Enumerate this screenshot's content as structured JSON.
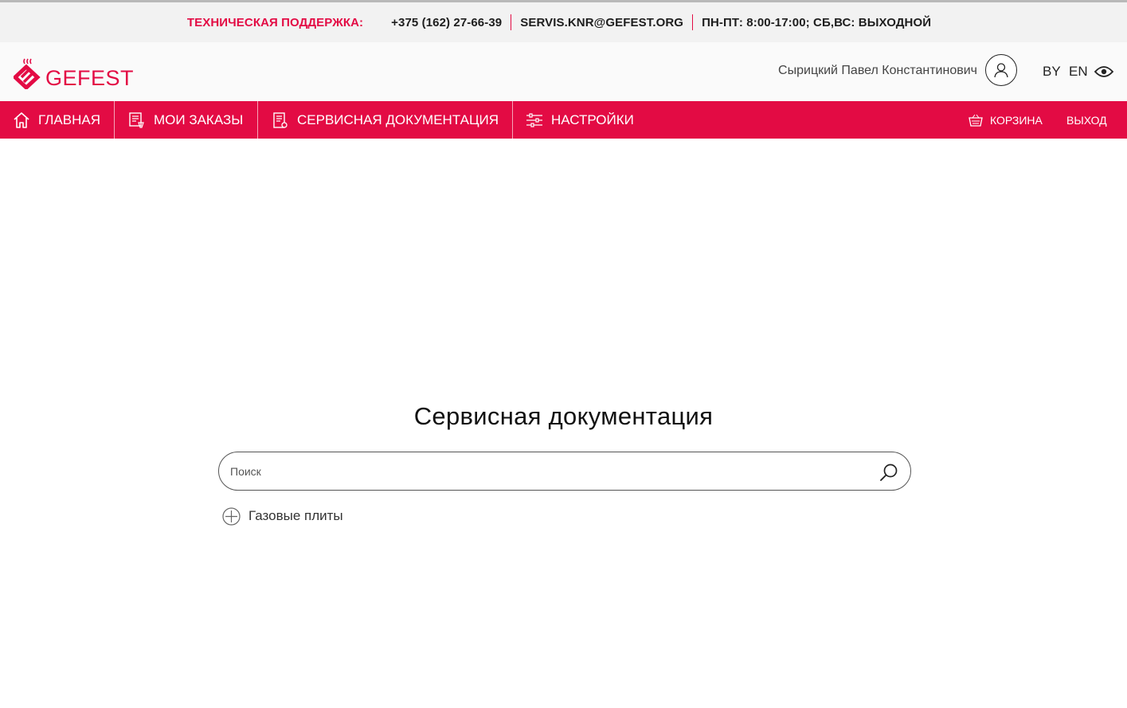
{
  "colors": {
    "brand": "#e30b44",
    "support_bar": "#f2f2f2",
    "header_bg": "#fafafa"
  },
  "support": {
    "label": "ТЕХНИЧЕСКАЯ ПОДДЕРЖКА:",
    "phone": "+375 (162) 27-66-39",
    "email": "SERVIS.KNR@GEFEST.ORG",
    "hours": "ПН-ПТ: 8:00-17:00; СБ,ВС: ВЫХОДНОЙ"
  },
  "header": {
    "logo_text": "GEFEST",
    "user_name": "Сырицкий Павел Константинович",
    "user_icon": "user-icon",
    "languages": [
      "BY",
      "EN"
    ],
    "accessibility_icon": "eye-icon"
  },
  "nav": {
    "items": [
      {
        "label": "ГЛАВНАЯ",
        "icon": "home-icon"
      },
      {
        "label": "МОИ ЗАКАЗЫ",
        "icon": "orders-icon"
      },
      {
        "label": "СЕРВИСНАЯ ДОКУМЕНТАЦИЯ",
        "icon": "document-icon"
      },
      {
        "label": "НАСТРОЙКИ",
        "icon": "settings-sliders-icon"
      }
    ],
    "cart_label": "КОРЗИНА",
    "cart_icon": "basket-icon",
    "logout_label": "ВЫХОД"
  },
  "main": {
    "title": "Сервисная документация",
    "search": {
      "placeholder": "Поиск",
      "value": "",
      "icon": "search-icon"
    },
    "categories": [
      {
        "label": "Газовые плиты",
        "icon": "plus-circle-icon",
        "expanded": false
      }
    ]
  }
}
